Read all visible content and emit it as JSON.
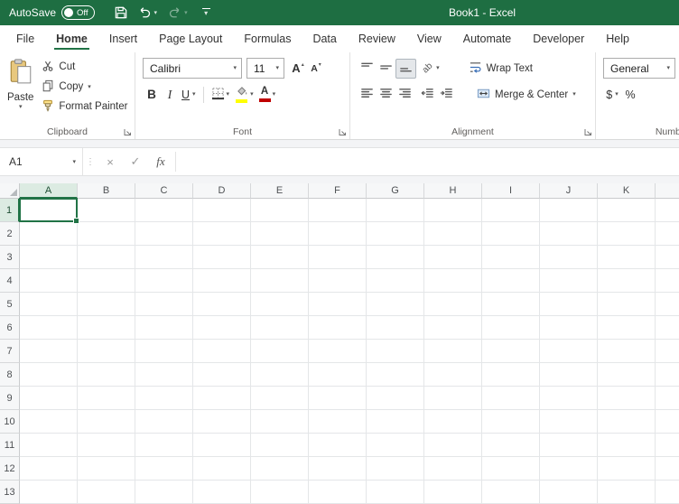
{
  "colors": {
    "title_bar": "#1e6e42",
    "excel_green": "#217346",
    "selection_border": "#217346",
    "header_sel": "#dcebe2",
    "fill_swatch": "#ffff00",
    "font_color_swatch": "#c00000"
  },
  "icons": {
    "chevron_down": "▾",
    "caret_up": "▴",
    "caret_down": "▾",
    "grip_dots": "⋮",
    "orientation_ab": "ab"
  },
  "titlebar": {
    "autosave_label": "AutoSave",
    "autosave_state": "Off",
    "title": "Book1 - Excel"
  },
  "ribbon_tabs": [
    {
      "label": "File",
      "active": false
    },
    {
      "label": "Home",
      "active": true
    },
    {
      "label": "Insert",
      "active": false
    },
    {
      "label": "Page Layout",
      "active": false
    },
    {
      "label": "Formulas",
      "active": false
    },
    {
      "label": "Data",
      "active": false
    },
    {
      "label": "Review",
      "active": false
    },
    {
      "label": "View",
      "active": false
    },
    {
      "label": "Automate",
      "active": false
    },
    {
      "label": "Developer",
      "active": false
    },
    {
      "label": "Help",
      "active": false
    }
  ],
  "ribbon": {
    "clipboard": {
      "group_label": "Clipboard",
      "paste_label": "Paste",
      "cut_label": "Cut",
      "copy_label": "Copy",
      "format_painter_label": "Format Painter"
    },
    "font": {
      "group_label": "Font",
      "font_name": "Calibri",
      "font_size": "11",
      "bold_label": "B",
      "italic_label": "I",
      "underline_label": "U",
      "font_color_label": "A"
    },
    "alignment": {
      "group_label": "Alignment",
      "wrap_text_label": "Wrap Text",
      "merge_center_label": "Merge & Center"
    },
    "number": {
      "group_label": "Number",
      "format_value": "General",
      "currency_label": "$",
      "percent_label": "%"
    }
  },
  "formula_bar": {
    "name_box": "A1",
    "cancel_glyph": "×",
    "enter_glyph": "✓",
    "fx_label": "fx",
    "formula_value": ""
  },
  "grid": {
    "columns": [
      "A",
      "B",
      "C",
      "D",
      "E",
      "F",
      "G",
      "H",
      "I",
      "J",
      "K"
    ],
    "rows": [
      "1",
      "2",
      "3",
      "4",
      "5",
      "6",
      "7",
      "8",
      "9",
      "10",
      "11",
      "12",
      "13"
    ],
    "selected_cell": "A1",
    "selected_column": "A",
    "selected_row": "1"
  }
}
